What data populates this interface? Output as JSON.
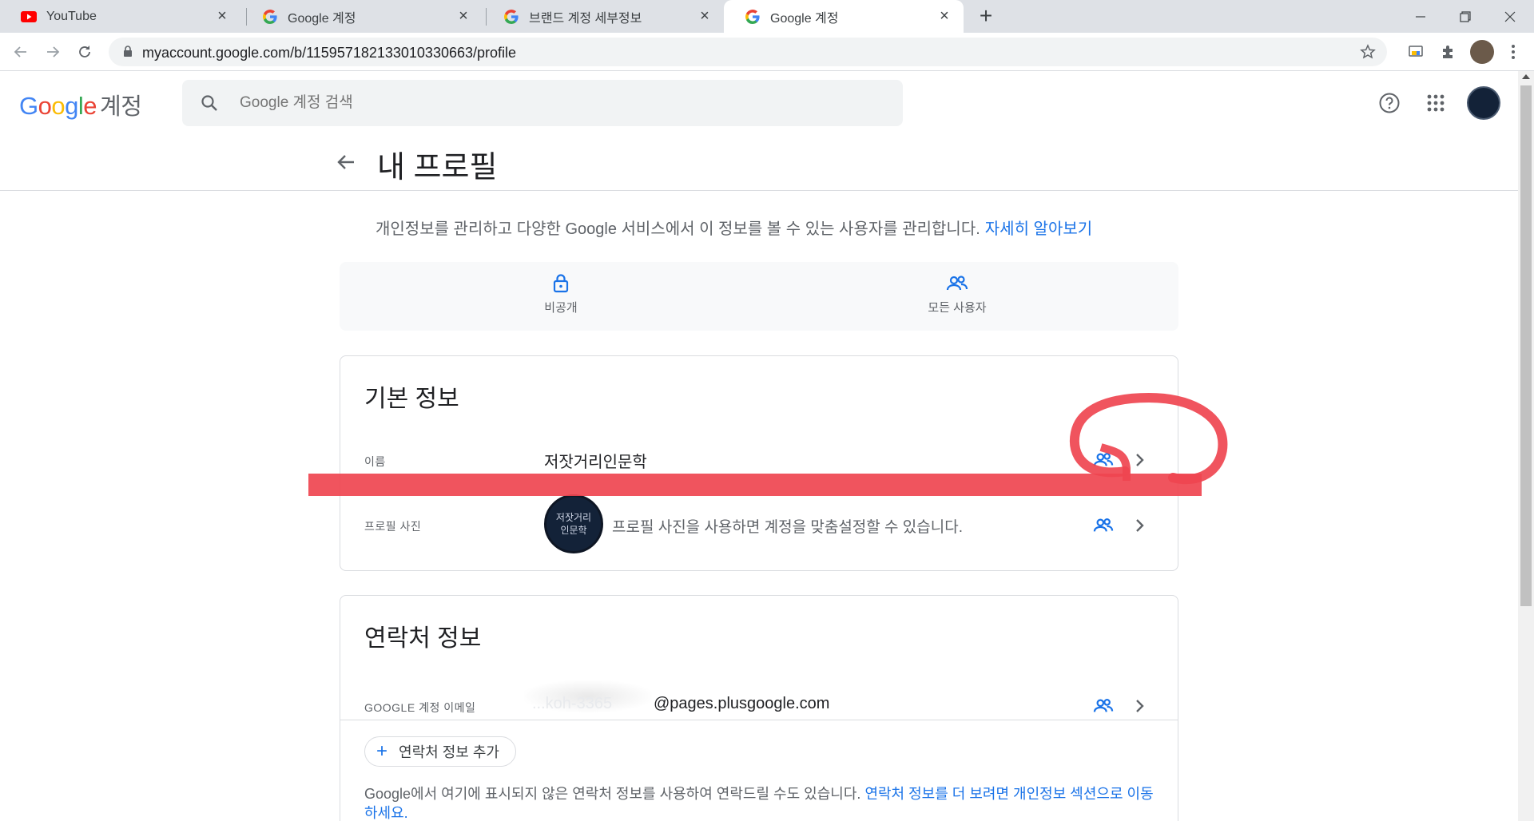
{
  "browser": {
    "tabs": [
      {
        "title": "YouTube",
        "icon": "youtube-icon",
        "active": false
      },
      {
        "title": "Google 계정",
        "icon": "google-icon",
        "active": false
      },
      {
        "title": "브랜드 계정 세부정보",
        "icon": "google-icon",
        "active": false
      },
      {
        "title": "Google 계정",
        "icon": "google-icon",
        "active": true
      }
    ],
    "url": "myaccount.google.com/b/115957182133010330663/profile"
  },
  "header": {
    "logo_google": "Google",
    "logo_account": "계정",
    "search_placeholder": "Google 계정 검색"
  },
  "page": {
    "title": "내 프로필",
    "intro": "개인정보를 관리하고 다양한 Google 서비스에서 이 정보를 볼 수 있는 사용자를 관리합니다.",
    "learn_more": "자세히 알아보기"
  },
  "visibility": {
    "private_label": "비공개",
    "everyone_label": "모든 사용자"
  },
  "basic_info": {
    "title": "기본 정보",
    "name_label": "이름",
    "name_value": "저잣거리인문학",
    "photo_label": "프로필 사진",
    "photo_text_line1": "저잣거리",
    "photo_text_line2": "인문학",
    "photo_desc": "프로필 사진을 사용하면 계정을 맞춤설정할 수 있습니다."
  },
  "contact_info": {
    "title": "연락처 정보",
    "email_label": "GOOGLE 계정 이메일",
    "email_value_partial": "@pages.plusgoogle.com",
    "email_value_obscured": "...koh-3365",
    "add_button": "연락처 정보 추가",
    "note_text": "Google에서 여기에 표시되지 않은 연락처 정보를 사용하여 연락드릴 수도 있습니다.",
    "note_link": "연락처 정보를 더 보려면 개인정보 섹션으로 이동하세요."
  },
  "colors": {
    "accent_blue": "#1a73e8",
    "annotation_red": "#ef4550",
    "tab_strip": "#dee1e6"
  }
}
